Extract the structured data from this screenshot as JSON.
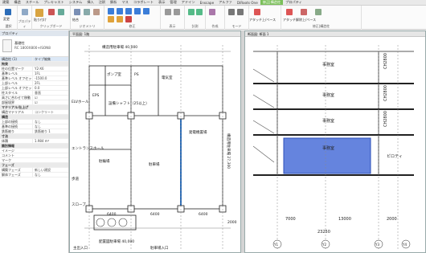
{
  "ribbon": {
    "tabs": [
      "建築",
      "構造",
      "スチール",
      "プレキャスト",
      "システム",
      "挿入",
      "注釈",
      "解析",
      "マス",
      "コラボレート",
      "表示",
      "管理",
      "アドイン",
      "Enscape",
      "アルファ",
      "DiRoots One",
      "修正|構造柱",
      "プロパティ"
    ],
    "active_tab": "修正|構造柱",
    "group_labels": [
      "選択",
      "プロパティ",
      "クリップボード",
      "ジオメトリ",
      "修正",
      "表示",
      "計測",
      "作成",
      "ビュー",
      "モード",
      "修正|構造柱"
    ],
    "tool_labels": [
      "変更",
      "貼り付け",
      "切り取り",
      "結合",
      "プロパティ",
      "アライメント",
      "移動",
      "コピー",
      "回転",
      "ミラー",
      "配列",
      "尺度",
      "アタッチ上/ベース",
      "アタッチ解除上/ベース",
      "梁/トラスへ",
      "解析"
    ],
    "accent_color": "#2b6cb8",
    "ctx_color": "#7bbf5a"
  },
  "properties": {
    "title": "プロパティ",
    "type_name": "基礎柱",
    "type_sub": "RC 1800X800+ISON8",
    "filter_label": "構造柱 (1)",
    "edit_type_label": "タイプ編集",
    "rows": [
      {
        "k": "拘束",
        "v": "",
        "sec": true
      },
      {
        "k": "柱の位置マーク",
        "v": "Y2-X6"
      },
      {
        "k": "基準レベル",
        "v": "1FL"
      },
      {
        "k": "基準レベル オフセット",
        "v": "-1500.0"
      },
      {
        "k": "上部レベル",
        "v": "2FL"
      },
      {
        "k": "上部レベル オフセット",
        "v": "0.0"
      },
      {
        "k": "柱スタイル",
        "v": "垂直"
      },
      {
        "k": "高さに合わせて移動",
        "v": "☑"
      },
      {
        "k": "部屋境界",
        "v": "☑"
      },
      {
        "k": "マテリアル/仕上げ",
        "v": "",
        "sec": true
      },
      {
        "k": "構造マテリアル",
        "v": "コンクリート"
      },
      {
        "k": "構造",
        "v": "",
        "sec": true
      },
      {
        "k": "上部の接続",
        "v": "なし"
      },
      {
        "k": "基準の接続",
        "v": "なし"
      },
      {
        "k": "鉄筋被り",
        "v": "鉄筋被り 1"
      },
      {
        "k": "寸法",
        "v": "",
        "sec": true
      },
      {
        "k": "体積",
        "v": "1.984 m³"
      },
      {
        "k": "識別情報",
        "v": "",
        "sec": true
      },
      {
        "k": "イメージ",
        "v": ""
      },
      {
        "k": "コメント",
        "v": ""
      },
      {
        "k": "マーク",
        "v": ""
      },
      {
        "k": "フェーズ",
        "v": "",
        "sec": true
      },
      {
        "k": "構築フェーズ",
        "v": "新しい建設"
      },
      {
        "k": "解体フェーズ",
        "v": "なし"
      }
    ]
  },
  "plan_view": {
    "title": "平面図: 1階",
    "labels": {
      "top_dim": "構造用駐車場 40,000",
      "pump": "ポンプ室",
      "ps": "PS",
      "eps": "EPS",
      "elv_hall": "ELVホール",
      "power": "電気室",
      "shaft": "設備シャフト（25以上）",
      "elec_gen": "発電機置場",
      "entrance": "エントランスホール",
      "parking": "駐車場",
      "pedestrian": "歩道",
      "ramp": "スロープ",
      "bicycle": "駐輪場",
      "mgmt": "管理室",
      "entry": "主出入口",
      "parking_entry": "駐車場入口",
      "right_dim": "構造用駐車場 27,300",
      "bottom_dim": "配置図駐車場 40,000"
    },
    "dims": [
      "6400",
      "6400",
      "6400",
      "2000"
    ],
    "axes": [
      "2",
      "3",
      "4"
    ]
  },
  "section_view": {
    "title": "断面図: 断面 1",
    "room_label": "事務室",
    "balcony": "ピロティ",
    "heights": [
      "CH2800",
      "CH2800",
      "CH2800",
      "CH2800"
    ],
    "dims": [
      "7000",
      "13000",
      "2000"
    ],
    "total": "23250",
    "axes": [
      "Y1",
      "Y2",
      "Y3",
      "Y4"
    ],
    "highlight_color": "#4a6ed8"
  }
}
